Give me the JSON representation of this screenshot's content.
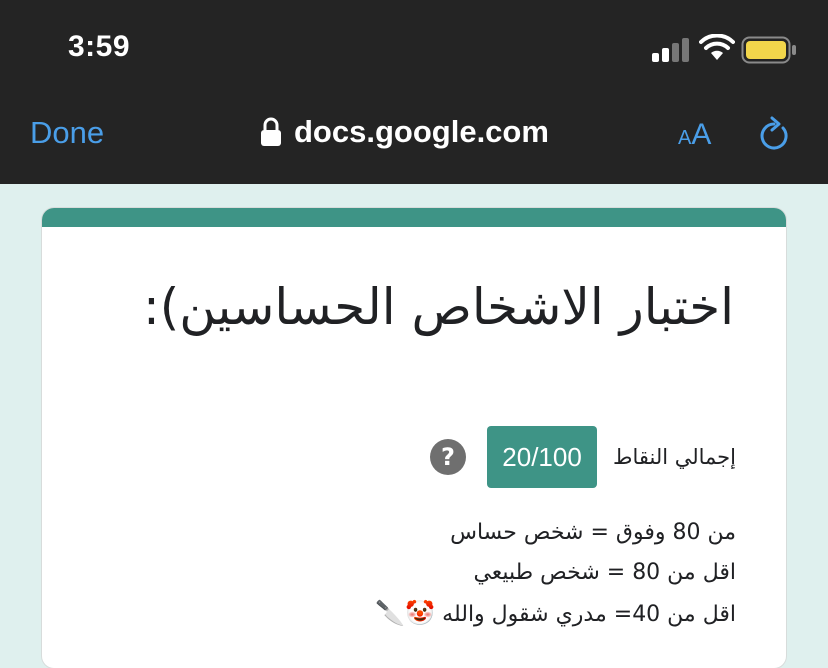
{
  "status_bar": {
    "time": "3:59",
    "icons": [
      "signal-icon",
      "wifi-icon",
      "battery-icon"
    ]
  },
  "browser": {
    "done_label": "Done",
    "url": "docs.google.com",
    "text_size_label_small": "A",
    "text_size_label_large": "A",
    "icons": [
      "lock-icon",
      "reload-icon"
    ],
    "accent_color": "#4a9ee8"
  },
  "form": {
    "accent_color": "#3e9486",
    "title": "اختبار الاشخاص الحساسين):",
    "score_label": "إجمالي النقاط",
    "score_value": "20/100",
    "help_icon": "help-icon",
    "description_lines": [
      "من 80 وفوق = شخص حساس",
      "اقل من 80 = شخص طبيعي",
      "اقل من 40= مدري شقول والله"
    ],
    "description_emoji": "🤡🔪"
  }
}
